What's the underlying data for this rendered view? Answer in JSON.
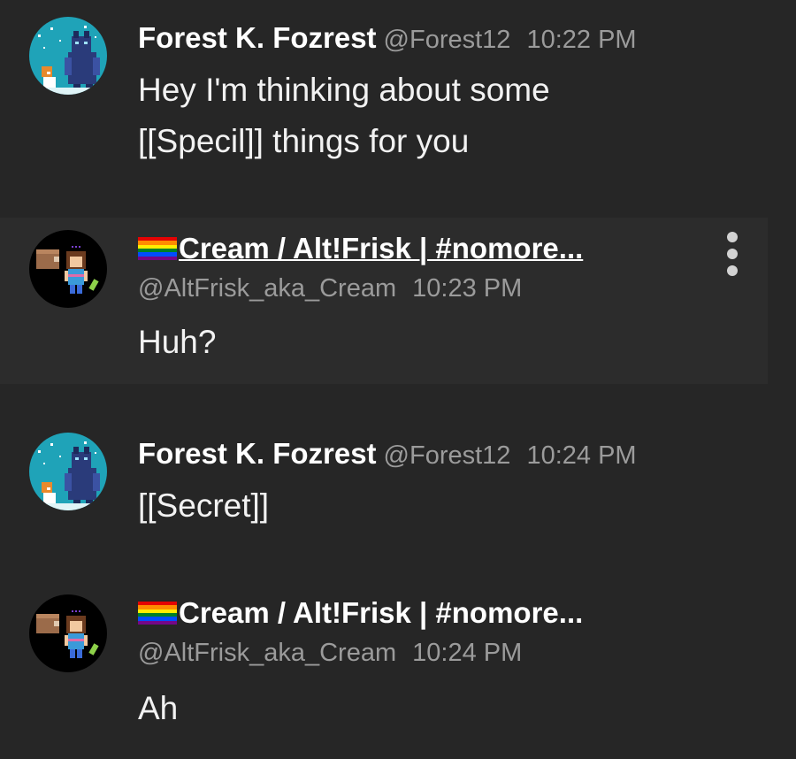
{
  "messages": [
    {
      "name": "Forest K. Fozrest",
      "handle": "@Forest12",
      "time": "10:22 PM",
      "text": "Hey I'm thinking about some\n[[Specil]] things for you",
      "avatar": "forest-avatar"
    },
    {
      "name": "Cream / Alt!Frisk | #nomore...",
      "handle": "@AltFrisk_aka_Cream",
      "time": "10:23 PM",
      "text": "Huh?",
      "avatar": "cream-avatar",
      "highlighted": true
    },
    {
      "name": "Forest K. Fozrest",
      "handle": "@Forest12",
      "time": "10:24 PM",
      "text": "[[Secret]]",
      "avatar": "forest-avatar"
    },
    {
      "name": "Cream / Alt!Frisk | #nomore...",
      "handle": "@AltFrisk_aka_Cream",
      "time": "10:24 PM",
      "text": "Ah",
      "avatar": "cream-avatar"
    }
  ],
  "icons": {
    "more_options": "more-options-icon",
    "flag": "rainbow-flag-icon"
  },
  "colors": {
    "background": "#262626",
    "highlight_background": "#2c2c2c",
    "name": "#ffffff",
    "meta": "#9b9b9b",
    "body": "#f2f2f2",
    "forest_avatar_bg": "#1fa3b8",
    "cream_avatar_bg": "#000000"
  }
}
